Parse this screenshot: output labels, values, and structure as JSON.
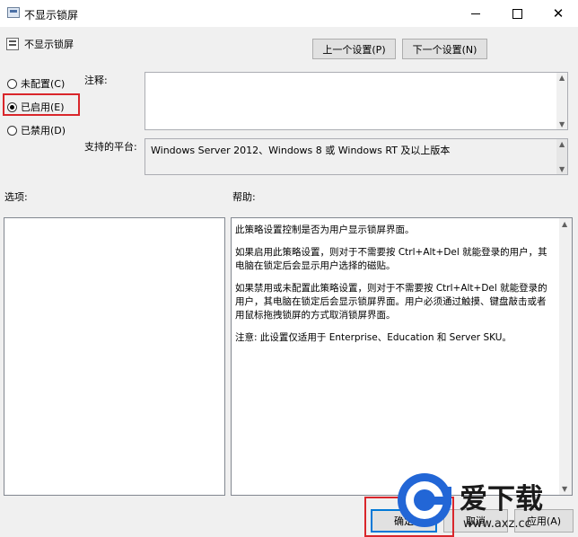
{
  "window": {
    "title": "不显示锁屏",
    "close_glyph": "✕",
    "controls": [
      "minimize-icon",
      "maximize-icon",
      "close-icon"
    ]
  },
  "header": {
    "policy_title": "不显示锁屏",
    "prev_button": "上一个设置(P)",
    "next_button": "下一个设置(N)"
  },
  "state": {
    "options": [
      {
        "label": "未配置(C)",
        "selected": false
      },
      {
        "label": "已启用(E)",
        "selected": true
      },
      {
        "label": "已禁用(D)",
        "selected": false
      }
    ]
  },
  "comment": {
    "label": "注释:",
    "value": ""
  },
  "platform": {
    "label": "支持的平台:",
    "value": "Windows Server 2012、Windows 8 或 Windows RT 及以上版本"
  },
  "options_panel": {
    "label": "选项:"
  },
  "help_panel": {
    "label": "帮助:",
    "paragraphs": [
      "此策略设置控制是否为用户显示锁屏界面。",
      "如果启用此策略设置，则对于不需要按 Ctrl+Alt+Del 就能登录的用户，其电脑在锁定后会显示用户选择的磁贴。",
      "如果禁用或未配置此策略设置，则对于不需要按 Ctrl+Alt+Del 就能登录的用户，其电脑在锁定后会显示锁屏界面。用户必须通过触摸、键盘敲击或者用鼠标拖拽锁屏的方式取消锁屏界面。",
      "注意: 此设置仅适用于 Enterprise、Education 和 Server SKU。"
    ]
  },
  "footer": {
    "ok_button": "确定",
    "cancel_button": "取消",
    "apply_button": "应用(A)"
  },
  "watermark": {
    "brand": "爱下载",
    "url": "www.axz.cc"
  },
  "colors": {
    "highlight": "#d9262b",
    "watermark_blue": "#2266d6",
    "dialog_bg": "#f0f0f0"
  }
}
